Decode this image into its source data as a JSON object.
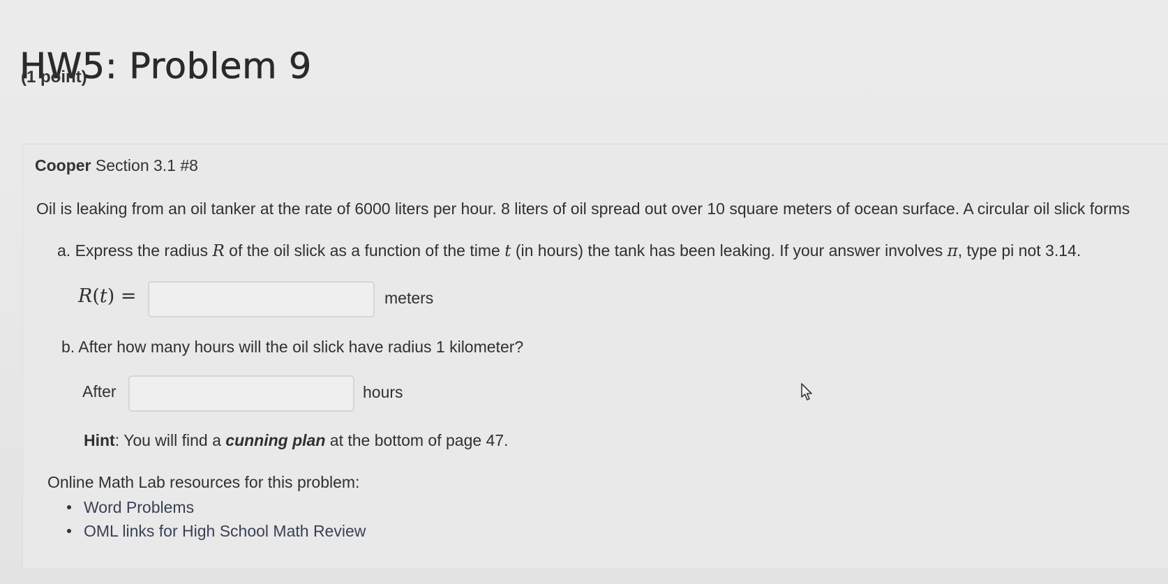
{
  "header": {
    "title": "HW5: Problem 9",
    "points": "(1 point)"
  },
  "problem": {
    "source_bold": "Cooper",
    "source_rest": " Section 3.1 #8",
    "statement": "Oil is leaking from an oil tanker at the rate of 6000 liters per hour. 8 liters of oil spread out over 10 square meters of ocean surface. A circular oil slick forms",
    "part_a": {
      "prefix": "a. Express the radius ",
      "var_r": "R",
      "mid": " of the oil slick as a function of the time ",
      "var_t": "t",
      "rest": " (in hours) the tank has been leaking. If your answer involves ",
      "pi": "π",
      "end": ", type pi not 3.14.",
      "label_func": "R",
      "label_open": "(",
      "label_var": "t",
      "label_close": ") =",
      "answer_value": "",
      "unit": "meters"
    },
    "part_b": {
      "question": "b. After how many hours will the oil slick have radius 1 kilometer?",
      "answer_prefix": "After",
      "answer_value": "",
      "unit": "hours"
    },
    "hint": {
      "label": "Hint",
      "text_before": ": You will find a ",
      "emphasis": "cunning plan",
      "text_after": " at the bottom of page 47."
    }
  },
  "resources": {
    "intro": "Online Math Lab resources for this problem:",
    "links": [
      {
        "label": "Word Problems"
      },
      {
        "label": "OML links for High School Math Review"
      }
    ]
  }
}
